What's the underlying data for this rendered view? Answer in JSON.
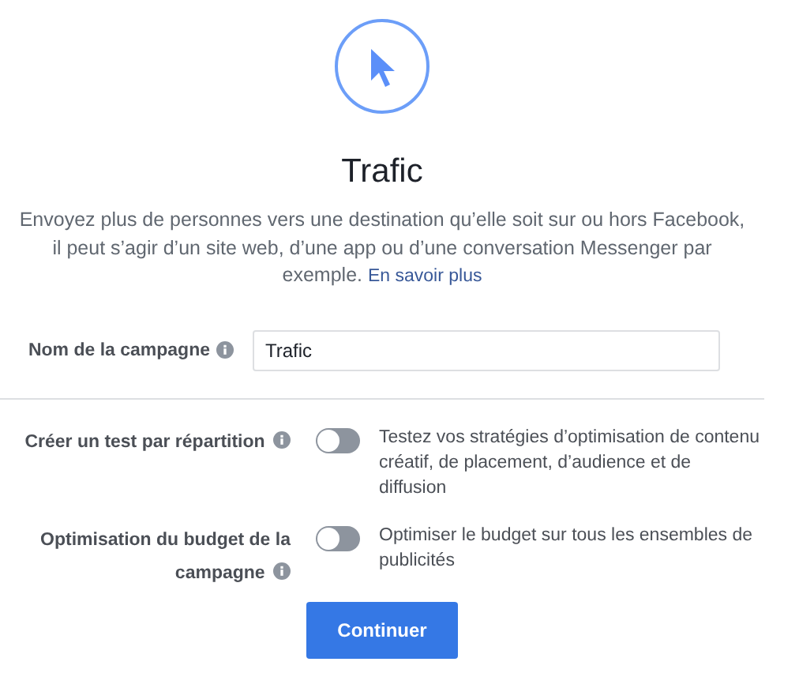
{
  "title": "Trafic",
  "description": "Envoyez plus de personnes vers une destination qu’elle soit sur ou hors Facebook, il peut s’agir d’un site web, d’une app ou d’une conversation Messenger par exemple.",
  "learn_more": "En savoir plus",
  "campaign_name": {
    "label": "Nom de la campagne",
    "value": "Trafic"
  },
  "options": [
    {
      "label": "Créer un test par répartition",
      "on": false,
      "description": "Testez vos stratégies d’optimisation de contenu créatif, de placement, d’audience et de diffusion"
    },
    {
      "label": "Optimisation du budget de la campagne",
      "on": false,
      "description": "Optimiser le budget sur tous les ensembles de publicités"
    }
  ],
  "button": "Continuer"
}
